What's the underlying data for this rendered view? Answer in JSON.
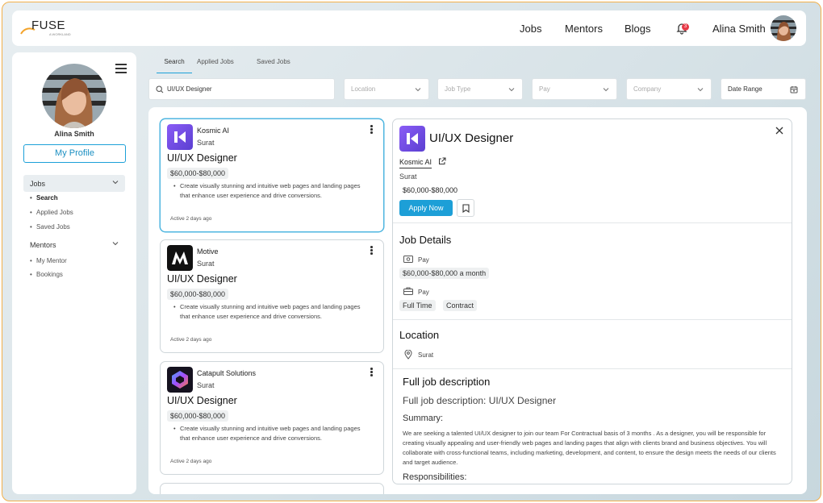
{
  "header": {
    "logo_text": "FUSE",
    "logo_sub": "A WORKLAND",
    "nav": [
      "Jobs",
      "Mentors",
      "Blogs"
    ],
    "notification_count": "3",
    "user_name": "Alina Smith"
  },
  "sidebar": {
    "user_name": "Alina Smith",
    "profile_button": "My Profile",
    "groups": [
      {
        "label": "Jobs",
        "items": [
          "Search",
          "Applied Jobs",
          "Saved Jobs"
        ],
        "active_item": "Search"
      },
      {
        "label": "Mentors",
        "items": [
          "My Mentor",
          "Bookings"
        ]
      }
    ]
  },
  "tabs": [
    "Search",
    "Applied Jobs",
    "Saved Jobs"
  ],
  "filters": {
    "search_value": "UI/UX Designer",
    "location": "Location",
    "job_type": "Job Type",
    "pay": "Pay",
    "company": "Company",
    "date_range": "Date Range"
  },
  "jobs": [
    {
      "company": "Kosmic AI",
      "location": "Surat",
      "title": "UI/UX Designer",
      "salary": "$60,000-$80,000",
      "description": "Create visually stunning and intuitive web pages and landing pages that enhance user experience and drive conversions.",
      "active": "Active 2 days ago"
    },
    {
      "company": "Motive",
      "location": "Surat",
      "title": "UI/UX Designer",
      "salary": "$60,000-$80,000",
      "description": "Create visually stunning and intuitive web pages and landing pages that enhance user experience and drive conversions.",
      "active": "Active 2 days ago"
    },
    {
      "company": "Catapult Solutions",
      "location": "Surat",
      "title": "UI/UX Designer",
      "salary": "$60,000-$80,000",
      "description": "Create visually stunning and intuitive web pages and landing pages that enhance user experience and drive conversions.",
      "active": "Active 2 days ago"
    }
  ],
  "detail": {
    "title": "UI/UX Designer",
    "company": "Kosmic AI",
    "city": "Surat",
    "salary": "$60,000-$80,000",
    "apply_label": "Apply Now",
    "job_details_heading": "Job Details",
    "pay_label": "Pay",
    "pay_value": "$60,000-$80,000 a month",
    "type_label": "Pay",
    "types": [
      "Full Time",
      "Contract"
    ],
    "location_heading": "Location",
    "location_value": "Surat",
    "full_desc_heading": "Full job description",
    "full_desc_sub": "Full job description: UI/UX Designer",
    "summary_heading": "Summary:",
    "summary_text": "We are seeking a talented UI/UX designer to join our team For Contractual basis of 3 months . As a designer, you will be responsible for creating visually appealing and user-friendly web pages and landing pages that align with clients brand and business objectives. You will collaborate with cross-functional teams, including marketing, development, and content, to ensure the design meets the needs of our clients and target audience.",
    "responsibilities_heading": "Responsibilities:"
  },
  "colors": {
    "accent": "#1d9fd7",
    "frame": "#f3b04a",
    "badge": "#e63946"
  }
}
